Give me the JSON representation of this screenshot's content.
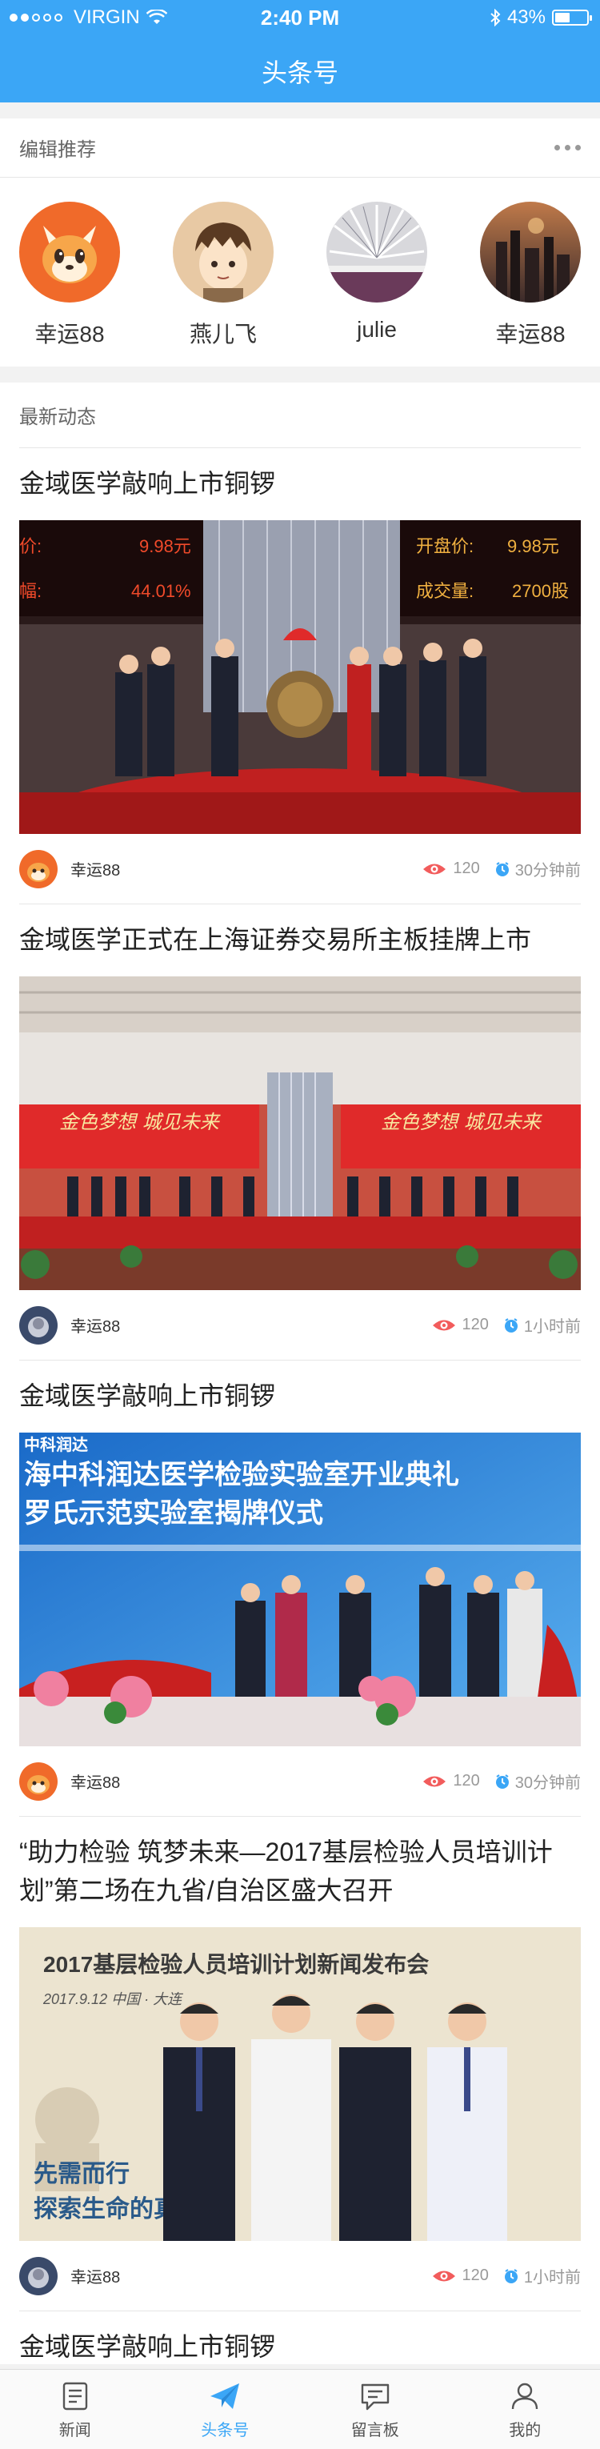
{
  "status_bar": {
    "carrier": "VIRGIN",
    "time": "2:40 PM",
    "battery": "43%"
  },
  "nav": {
    "title": "头条号"
  },
  "editors": {
    "title": "编辑推荐",
    "people": [
      {
        "name": "幸运88",
        "avatar": "fox-avatar"
      },
      {
        "name": "燕儿飞",
        "avatar": "boy-avatar"
      },
      {
        "name": "julie",
        "avatar": "book-avatar"
      },
      {
        "name": "幸运88",
        "avatar": "city-avatar"
      }
    ]
  },
  "feed": {
    "title": "最新动态",
    "articles": [
      {
        "title": "金域医学敲响上市铜锣",
        "image": "gong-ceremony",
        "image_text": {
          "left_top": "价:",
          "left_top_val": "9.98元",
          "left_bottom": "幅:",
          "left_bottom_val": "44.01%",
          "right_top": "开盘价:",
          "right_top_val": "9.98元",
          "right_bottom": "成交量:",
          "right_bottom_val": "2700股"
        },
        "author": "幸运88",
        "avatar": "fox-avatar",
        "views": "120",
        "time": "30分钟前"
      },
      {
        "title": "金域医学正式在上海证券交易所主板挂牌上市",
        "image": "exchange-hall",
        "image_text": {
          "banner_left": "金色梦想  城见未来",
          "banner_right": "金色梦想  城见未来"
        },
        "author": "幸运88",
        "avatar": "boy-avatar",
        "views": "120",
        "time": "1小时前"
      },
      {
        "title": "金域医学敲响上市铜锣",
        "image": "lab-opening",
        "image_text": {
          "logo": "中科润达",
          "line1": "海中科润达医学检验实验室开业典礼",
          "line2": "罗氏示范实验室揭牌仪式"
        },
        "author": "幸运88",
        "avatar": "fox-avatar",
        "views": "120",
        "time": "30分钟前"
      },
      {
        "title": "“助力检验 筑梦未来—2017基层检验人员培训计划”第二场在九省/自治区盛大召开",
        "image": "training-conference",
        "image_text": {
          "headline": "2017基层检验人员培训计划新闻发布会",
          "date": "2017.9.12  中国 · 大连",
          "slogan1": "先需而行",
          "slogan2": "探索生命的真"
        },
        "author": "幸运88",
        "avatar": "boy-avatar",
        "views": "120",
        "time": "1小时前"
      },
      {
        "title": "金域医学敲响上市铜锣"
      }
    ]
  },
  "tabbar": {
    "tabs": [
      {
        "label": "新闻",
        "icon": "news-icon"
      },
      {
        "label": "头条号",
        "icon": "paper-plane-icon"
      },
      {
        "label": "留言板",
        "icon": "message-board-icon"
      },
      {
        "label": "我的",
        "icon": "user-icon"
      }
    ],
    "active": "头条号"
  },
  "colors": {
    "primary": "#3ba6f6",
    "eye": "#f25c5c",
    "clock": "#3ba6f6"
  }
}
